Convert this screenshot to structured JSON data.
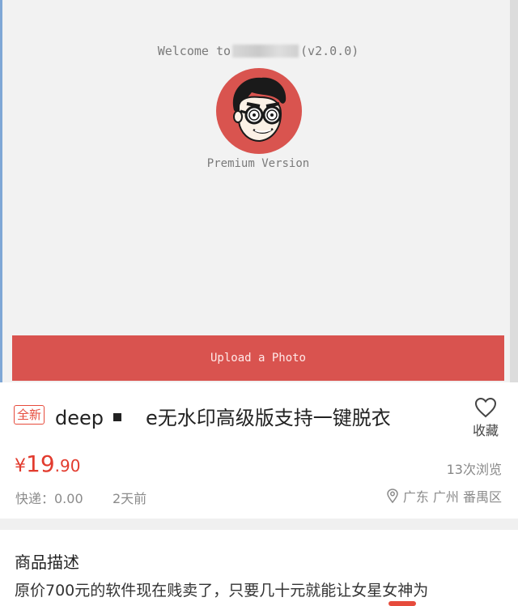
{
  "app": {
    "welcome_prefix": "Welcome to",
    "welcome_suffix": "(v2.0.0)",
    "edition": "Premium Version",
    "upload_label": "Upload a Photo"
  },
  "listing": {
    "badge": "全新",
    "title_start": "deep",
    "title_end": "e无水印高级版支持一键脱衣",
    "favorite_label": "收藏",
    "price_currency": "¥",
    "price_integer": "19",
    "price_decimal": ".90",
    "views": "13次浏览",
    "shipping": "快递：0.00",
    "posted": "2天前",
    "location": "广东 广州 番禺区"
  },
  "description": {
    "heading": "商品描述",
    "text": "原价700元的软件现在贱卖了，只要几十元就能让女星女神为"
  },
  "colors": {
    "accent_red": "#e23b2e",
    "button_red": "#d9534f"
  },
  "icons": [
    "heart-outline-icon",
    "location-pin-icon",
    "cartoon-logo"
  ]
}
